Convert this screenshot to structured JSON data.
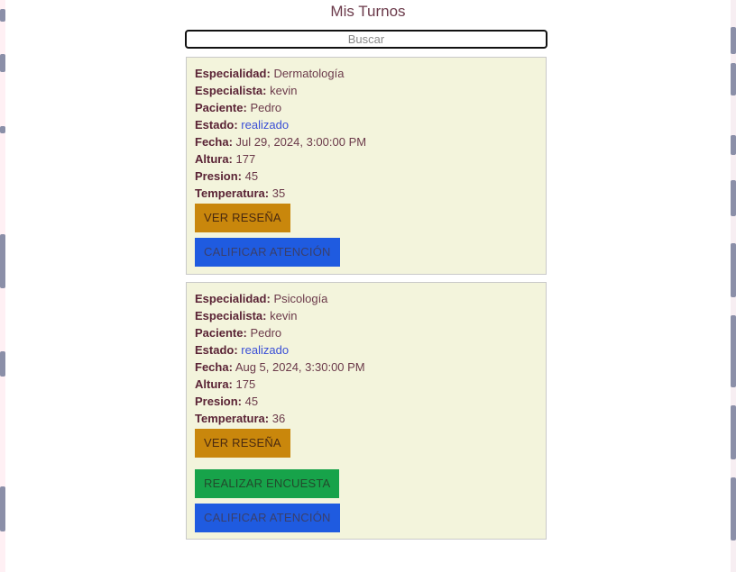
{
  "header": {
    "title": "Mis Turnos"
  },
  "search": {
    "placeholder": "Buscar"
  },
  "labels": {
    "especialidad": "Especialidad:",
    "especialista": "Especialista:",
    "paciente": "Paciente:",
    "estado": "Estado:",
    "fecha": "Fecha:",
    "altura": "Altura:",
    "presion": "Presion:",
    "temperatura": "Temperatura:"
  },
  "buttons": {
    "ver_resena": "VER RESEÑA",
    "calificar": "CALIFICAR ATENCIÓN",
    "encuesta": "REALIZAR ENCUESTA"
  },
  "turnos": [
    {
      "especialidad": "Dermatología",
      "especialista": "kevin",
      "paciente": "Pedro",
      "estado": "realizado",
      "fecha": "Jul 29, 2024, 3:00:00 PM",
      "altura": "177",
      "presion": "45",
      "temperatura": "35"
    },
    {
      "especialidad": "Psicología",
      "especialista": "kevin",
      "paciente": "Pedro",
      "estado": "realizado",
      "fecha": "Aug 5, 2024, 3:30:00 PM",
      "altura": "175",
      "presion": "45",
      "temperatura": "36"
    }
  ],
  "colors": {
    "card_bg": "#f3f4dc",
    "resena": "#c9870c",
    "calificar": "#1f5be0",
    "encuesta": "#17a34a",
    "estado": "#3a4fd6"
  }
}
